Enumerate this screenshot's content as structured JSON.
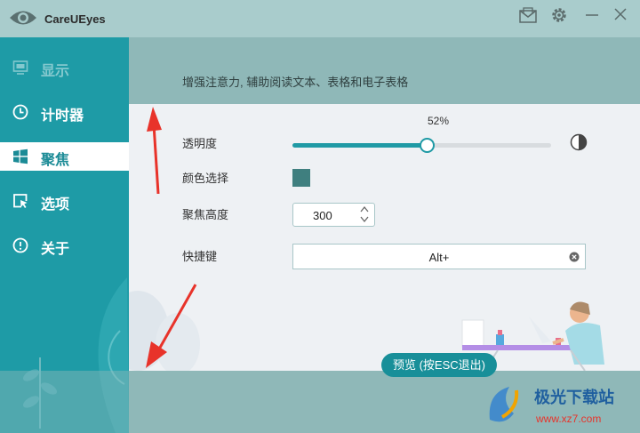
{
  "app": {
    "title": "CareUEyes"
  },
  "titlebar": {
    "icons": [
      "mail-icon",
      "gear-icon",
      "minimize-icon",
      "close-icon"
    ]
  },
  "sidebar": {
    "items": [
      {
        "label": "显示",
        "icon": "monitor-icon",
        "active": false
      },
      {
        "label": "计时器",
        "icon": "clock-icon",
        "active": false
      },
      {
        "label": "聚焦",
        "icon": "windows-icon",
        "active": true
      },
      {
        "label": "选项",
        "icon": "select-icon",
        "active": false
      },
      {
        "label": "关于",
        "icon": "info-icon",
        "active": false
      }
    ]
  },
  "focus": {
    "description": "增强注意力, 辅助阅读文本、表格和电子表格",
    "opacity": {
      "label": "透明度",
      "value": 52,
      "display": "52%"
    },
    "color": {
      "label": "颜色选择",
      "value": "#3f7f7f"
    },
    "height": {
      "label": "聚焦高度",
      "value": "300"
    },
    "hotkey": {
      "label": "快捷键",
      "value": "Alt+"
    },
    "preview_button": "预览 (按ESC退出)"
  },
  "watermark": {
    "text": "极光下载站",
    "url": "www.xz7.com"
  },
  "colors": {
    "accent": "#1f9aa5",
    "sidebar": "#1e9ba6",
    "overlay": "#8fb8b8",
    "annotation": "#e8332a"
  }
}
